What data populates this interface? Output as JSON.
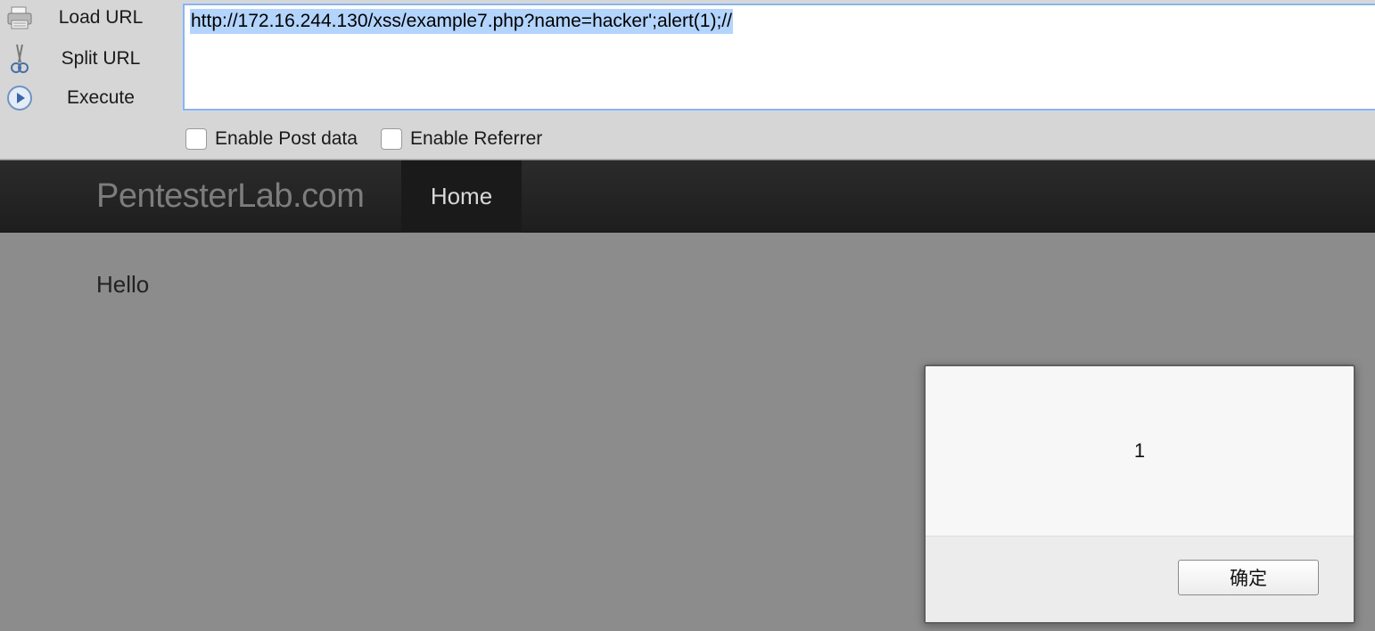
{
  "hackbar": {
    "load_url_label": "Load URL",
    "split_url_label": "Split URL",
    "execute_label": "Execute",
    "url_value": "http://172.16.244.130/xss/example7.php?name=hacker';alert(1);//",
    "enable_post_label": "Enable Post data",
    "enable_referrer_label": "Enable Referrer",
    "enable_post_checked": false,
    "enable_referrer_checked": false
  },
  "site": {
    "brand": "PentesterLab.com",
    "nav_home": "Home",
    "greeting": "Hello"
  },
  "alert": {
    "message": "1",
    "ok_label": "确定"
  },
  "icons": {
    "load_url": "printer-icon",
    "split_url": "scissors-icon",
    "execute": "play-icon"
  },
  "colors": {
    "selection": "#b3d4fc",
    "url_focus_border": "#8db4e6",
    "toolbar_bg": "#d6d6d6",
    "navbar_bg": "#222222",
    "page_bg": "#8c8c8c"
  }
}
